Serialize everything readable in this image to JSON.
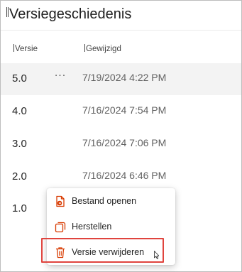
{
  "panel": {
    "title": "Versiegeschiedenis"
  },
  "columns": {
    "version": "Versie",
    "modified": "Gewijzigd"
  },
  "rows": [
    {
      "version": "5.0",
      "modified": "7/19/2024 4:22 PM",
      "more": "..."
    },
    {
      "version": "4.0",
      "modified": "7/16/2024 7:54 PM"
    },
    {
      "version": "3.0",
      "modified": "7/16/2024 7:06 PM"
    },
    {
      "version": "2.0",
      "modified": "7/16/2024 6:46 PM"
    },
    {
      "version": "1.0"
    }
  ],
  "context_menu": {
    "items": [
      {
        "label": "Bestand openen",
        "icon": "file-open-icon"
      },
      {
        "label": "Herstellen",
        "icon": "restore-icon"
      },
      {
        "label": "Versie verwijderen",
        "icon": "trash-icon"
      }
    ]
  },
  "colors": {
    "accent": "#d83b01",
    "highlight_border": "#e0443e"
  }
}
